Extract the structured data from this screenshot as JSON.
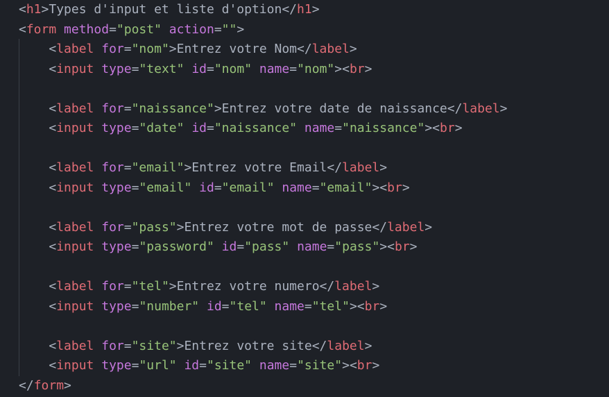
{
  "editor": {
    "indent_unit": "    ",
    "colors": {
      "background": "#1e2127",
      "punct": "#abb2bf",
      "tag": "#e06c75",
      "attr": "#c678dd",
      "str": "#98c379",
      "text": "#abb2bf",
      "indent_guide": "#3b4048"
    },
    "lines": [
      {
        "indent": 0,
        "tokens": [
          [
            "punct",
            "<"
          ],
          [
            "tag",
            "h1"
          ],
          [
            "punct",
            ">"
          ],
          [
            "text",
            "Types d'input et liste d'option"
          ],
          [
            "punct",
            "</"
          ],
          [
            "tag",
            "h1"
          ],
          [
            "punct",
            ">"
          ]
        ]
      },
      {
        "indent": 0,
        "tokens": [
          [
            "punct",
            "<"
          ],
          [
            "tag",
            "form"
          ],
          [
            "text",
            " "
          ],
          [
            "attr",
            "method"
          ],
          [
            "punct",
            "="
          ],
          [
            "str",
            "\"post\""
          ],
          [
            "text",
            " "
          ],
          [
            "attr",
            "action"
          ],
          [
            "punct",
            "="
          ],
          [
            "str",
            "\"\""
          ],
          [
            "punct",
            ">"
          ]
        ]
      },
      {
        "indent": 1,
        "tokens": [
          [
            "punct",
            "<"
          ],
          [
            "tag",
            "label"
          ],
          [
            "text",
            " "
          ],
          [
            "attr",
            "for"
          ],
          [
            "punct",
            "="
          ],
          [
            "str",
            "\"nom\""
          ],
          [
            "punct",
            ">"
          ],
          [
            "text",
            "Entrez votre Nom"
          ],
          [
            "punct",
            "</"
          ],
          [
            "tag",
            "label"
          ],
          [
            "punct",
            ">"
          ]
        ]
      },
      {
        "indent": 1,
        "tokens": [
          [
            "punct",
            "<"
          ],
          [
            "tag",
            "input"
          ],
          [
            "text",
            " "
          ],
          [
            "attr",
            "type"
          ],
          [
            "punct",
            "="
          ],
          [
            "str",
            "\"text\""
          ],
          [
            "text",
            " "
          ],
          [
            "attr",
            "id"
          ],
          [
            "punct",
            "="
          ],
          [
            "str",
            "\"nom\""
          ],
          [
            "text",
            " "
          ],
          [
            "attr",
            "name"
          ],
          [
            "punct",
            "="
          ],
          [
            "str",
            "\"nom\""
          ],
          [
            "punct",
            ">"
          ],
          [
            "punct",
            "<"
          ],
          [
            "tag",
            "br"
          ],
          [
            "punct",
            ">"
          ]
        ]
      },
      {
        "indent": 0,
        "tokens": []
      },
      {
        "indent": 1,
        "tokens": [
          [
            "punct",
            "<"
          ],
          [
            "tag",
            "label"
          ],
          [
            "text",
            " "
          ],
          [
            "attr",
            "for"
          ],
          [
            "punct",
            "="
          ],
          [
            "str",
            "\"naissance\""
          ],
          [
            "punct",
            ">"
          ],
          [
            "text",
            "Entrez votre date de naissance"
          ],
          [
            "punct",
            "</"
          ],
          [
            "tag",
            "label"
          ],
          [
            "punct",
            ">"
          ]
        ]
      },
      {
        "indent": 1,
        "tokens": [
          [
            "punct",
            "<"
          ],
          [
            "tag",
            "input"
          ],
          [
            "text",
            " "
          ],
          [
            "attr",
            "type"
          ],
          [
            "punct",
            "="
          ],
          [
            "str",
            "\"date\""
          ],
          [
            "text",
            " "
          ],
          [
            "attr",
            "id"
          ],
          [
            "punct",
            "="
          ],
          [
            "str",
            "\"naissance\""
          ],
          [
            "text",
            " "
          ],
          [
            "attr",
            "name"
          ],
          [
            "punct",
            "="
          ],
          [
            "str",
            "\"naissance\""
          ],
          [
            "punct",
            ">"
          ],
          [
            "punct",
            "<"
          ],
          [
            "tag",
            "br"
          ],
          [
            "punct",
            ">"
          ]
        ]
      },
      {
        "indent": 0,
        "tokens": []
      },
      {
        "indent": 1,
        "tokens": [
          [
            "punct",
            "<"
          ],
          [
            "tag",
            "label"
          ],
          [
            "text",
            " "
          ],
          [
            "attr",
            "for"
          ],
          [
            "punct",
            "="
          ],
          [
            "str",
            "\"email\""
          ],
          [
            "punct",
            ">"
          ],
          [
            "text",
            "Entrez votre Email"
          ],
          [
            "punct",
            "</"
          ],
          [
            "tag",
            "label"
          ],
          [
            "punct",
            ">"
          ]
        ]
      },
      {
        "indent": 1,
        "tokens": [
          [
            "punct",
            "<"
          ],
          [
            "tag",
            "input"
          ],
          [
            "text",
            " "
          ],
          [
            "attr",
            "type"
          ],
          [
            "punct",
            "="
          ],
          [
            "str",
            "\"email\""
          ],
          [
            "text",
            " "
          ],
          [
            "attr",
            "id"
          ],
          [
            "punct",
            "="
          ],
          [
            "str",
            "\"email\""
          ],
          [
            "text",
            " "
          ],
          [
            "attr",
            "name"
          ],
          [
            "punct",
            "="
          ],
          [
            "str",
            "\"email\""
          ],
          [
            "punct",
            ">"
          ],
          [
            "punct",
            "<"
          ],
          [
            "tag",
            "br"
          ],
          [
            "punct",
            ">"
          ]
        ]
      },
      {
        "indent": 0,
        "tokens": []
      },
      {
        "indent": 1,
        "tokens": [
          [
            "punct",
            "<"
          ],
          [
            "tag",
            "label"
          ],
          [
            "text",
            " "
          ],
          [
            "attr",
            "for"
          ],
          [
            "punct",
            "="
          ],
          [
            "str",
            "\"pass\""
          ],
          [
            "punct",
            ">"
          ],
          [
            "text",
            "Entrez votre mot de passe"
          ],
          [
            "punct",
            "</"
          ],
          [
            "tag",
            "label"
          ],
          [
            "punct",
            ">"
          ]
        ]
      },
      {
        "indent": 1,
        "tokens": [
          [
            "punct",
            "<"
          ],
          [
            "tag",
            "input"
          ],
          [
            "text",
            " "
          ],
          [
            "attr",
            "type"
          ],
          [
            "punct",
            "="
          ],
          [
            "str",
            "\"password\""
          ],
          [
            "text",
            " "
          ],
          [
            "attr",
            "id"
          ],
          [
            "punct",
            "="
          ],
          [
            "str",
            "\"pass\""
          ],
          [
            "text",
            " "
          ],
          [
            "attr",
            "name"
          ],
          [
            "punct",
            "="
          ],
          [
            "str",
            "\"pass\""
          ],
          [
            "punct",
            ">"
          ],
          [
            "punct",
            "<"
          ],
          [
            "tag",
            "br"
          ],
          [
            "punct",
            ">"
          ]
        ]
      },
      {
        "indent": 0,
        "tokens": []
      },
      {
        "indent": 1,
        "tokens": [
          [
            "punct",
            "<"
          ],
          [
            "tag",
            "label"
          ],
          [
            "text",
            " "
          ],
          [
            "attr",
            "for"
          ],
          [
            "punct",
            "="
          ],
          [
            "str",
            "\"tel\""
          ],
          [
            "punct",
            ">"
          ],
          [
            "text",
            "Entrez votre numero"
          ],
          [
            "punct",
            "</"
          ],
          [
            "tag",
            "label"
          ],
          [
            "punct",
            ">"
          ]
        ]
      },
      {
        "indent": 1,
        "tokens": [
          [
            "punct",
            "<"
          ],
          [
            "tag",
            "input"
          ],
          [
            "text",
            " "
          ],
          [
            "attr",
            "type"
          ],
          [
            "punct",
            "="
          ],
          [
            "str",
            "\"number\""
          ],
          [
            "text",
            " "
          ],
          [
            "attr",
            "id"
          ],
          [
            "punct",
            "="
          ],
          [
            "str",
            "\"tel\""
          ],
          [
            "text",
            " "
          ],
          [
            "attr",
            "name"
          ],
          [
            "punct",
            "="
          ],
          [
            "str",
            "\"tel\""
          ],
          [
            "punct",
            ">"
          ],
          [
            "punct",
            "<"
          ],
          [
            "tag",
            "br"
          ],
          [
            "punct",
            ">"
          ]
        ]
      },
      {
        "indent": 0,
        "tokens": []
      },
      {
        "indent": 1,
        "tokens": [
          [
            "punct",
            "<"
          ],
          [
            "tag",
            "label"
          ],
          [
            "text",
            " "
          ],
          [
            "attr",
            "for"
          ],
          [
            "punct",
            "="
          ],
          [
            "str",
            "\"site\""
          ],
          [
            "punct",
            ">"
          ],
          [
            "text",
            "Entrez votre site"
          ],
          [
            "punct",
            "</"
          ],
          [
            "tag",
            "label"
          ],
          [
            "punct",
            ">"
          ]
        ]
      },
      {
        "indent": 1,
        "tokens": [
          [
            "punct",
            "<"
          ],
          [
            "tag",
            "input"
          ],
          [
            "text",
            " "
          ],
          [
            "attr",
            "type"
          ],
          [
            "punct",
            "="
          ],
          [
            "str",
            "\"url\""
          ],
          [
            "text",
            " "
          ],
          [
            "attr",
            "id"
          ],
          [
            "punct",
            "="
          ],
          [
            "str",
            "\"site\""
          ],
          [
            "text",
            " "
          ],
          [
            "attr",
            "name"
          ],
          [
            "punct",
            "="
          ],
          [
            "str",
            "\"site\""
          ],
          [
            "punct",
            ">"
          ],
          [
            "punct",
            "<"
          ],
          [
            "tag",
            "br"
          ],
          [
            "punct",
            ">"
          ]
        ]
      },
      {
        "indent": 0,
        "tokens": [
          [
            "punct",
            "</"
          ],
          [
            "tag",
            "form"
          ],
          [
            "punct",
            ">"
          ]
        ]
      }
    ]
  }
}
